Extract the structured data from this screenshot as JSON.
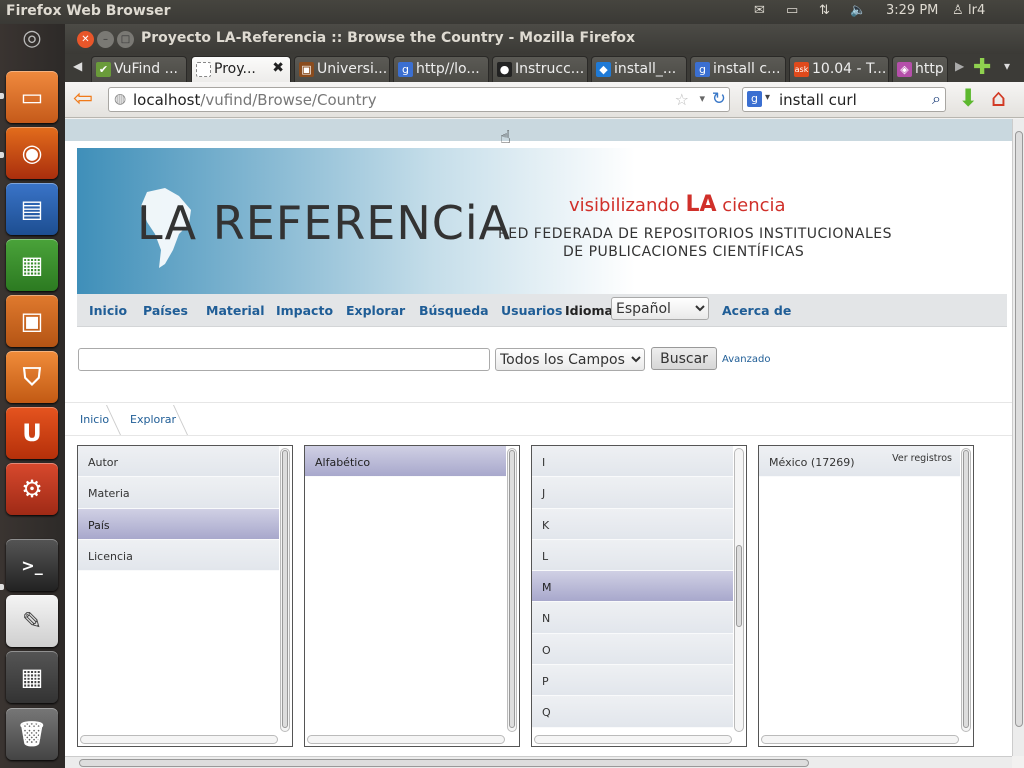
{
  "system": {
    "app_name": "Firefox Web Browser",
    "time": "3:29 PM",
    "user": "lr4"
  },
  "window": {
    "title": "Proyecto LA-Referencia :: Browse the Country - Mozilla Firefox"
  },
  "tabs": [
    {
      "label": "VuFind ..."
    },
    {
      "label": "Proy..."
    },
    {
      "label": "Universi..."
    },
    {
      "label": "http//lo..."
    },
    {
      "label": "Instrucc..."
    },
    {
      "label": "install_..."
    },
    {
      "label": "install c..."
    },
    {
      "label": "10.04 - T..."
    },
    {
      "label": "http"
    }
  ],
  "navbar": {
    "url_host": "localhost",
    "url_path": "/vufind/Browse/Country",
    "search_value": "install curl"
  },
  "banner": {
    "logo_text": "LA REFERENCiA",
    "slogan_pre": "visibilizando ",
    "slogan_la": "LA",
    "slogan_post": " ciencia",
    "line1": "RED FEDERADA DE REPOSITORIOS INSTITUCIONALES",
    "line2": "DE PUBLICACIONES CIENTÍFICAS"
  },
  "menu": {
    "items": [
      "Inicio",
      "Países",
      "Material",
      "Impacto",
      "Explorar",
      "Búsqueda",
      "Usuarios"
    ],
    "idioma_label": "Idioma:",
    "idioma_value": "Español",
    "about": "Acerca de"
  },
  "search": {
    "field_value": "",
    "scope": "Todos los Campos",
    "button": "Buscar",
    "advanced": "Avanzado"
  },
  "breadcrumb": [
    "Inicio",
    "Explorar"
  ],
  "browse": {
    "col1": [
      "Autor",
      "Materia",
      "País",
      "Licencia"
    ],
    "col1_selected": 2,
    "col2": [
      "Alfabético"
    ],
    "col2_selected": 0,
    "col3": [
      "I",
      "J",
      "K",
      "L",
      "M",
      "N",
      "O",
      "P",
      "Q"
    ],
    "col3_selected": 4,
    "col4": [
      {
        "label": "México (17269)",
        "link": "Ver registros"
      }
    ]
  }
}
